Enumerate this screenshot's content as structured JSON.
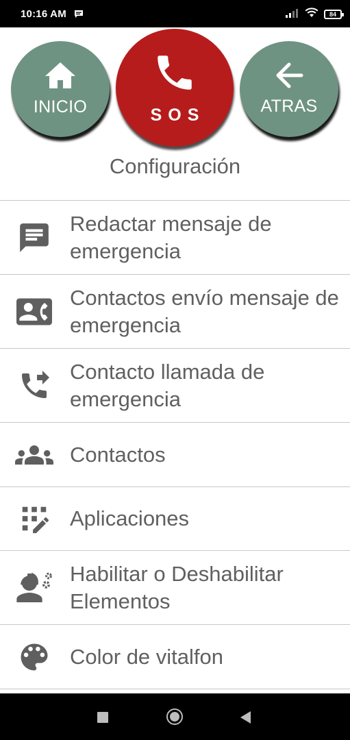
{
  "status_bar": {
    "time": "10:16 AM",
    "battery": "84",
    "icons": [
      "chat-bubble-icon",
      "signal-icon",
      "wifi-icon",
      "battery-icon"
    ]
  },
  "top_buttons": {
    "home": {
      "label": "INICIO",
      "icon": "home-icon",
      "color": "#6f9382"
    },
    "sos": {
      "label": "SOS",
      "icon": "phone-icon",
      "color": "#b71c1c"
    },
    "back": {
      "label": "ATRAS",
      "icon": "arrow-left-icon",
      "color": "#6f9382"
    }
  },
  "page": {
    "title": "Configuración"
  },
  "menu": {
    "items": [
      {
        "label": "Redactar mensaje de emergencia",
        "icon": "message-icon"
      },
      {
        "label": "Contactos envío mensaje de emergencia",
        "icon": "contact-phone-icon"
      },
      {
        "label": "Contacto llamada de emergencia",
        "icon": "phone-forwarded-icon"
      },
      {
        "label": "Contactos",
        "icon": "group-icon"
      },
      {
        "label": "Aplicaciones",
        "icon": "apps-edit-icon"
      },
      {
        "label": "Habilitar o Deshabilitar Elementos",
        "icon": "engineer-icon"
      },
      {
        "label": "Color de vitalfon",
        "icon": "palette-icon"
      }
    ]
  },
  "nav_bar": {
    "icons": [
      "recent-apps-icon",
      "home-circle-icon",
      "back-triangle-icon"
    ]
  },
  "colors": {
    "icon_gray": "#5f5f5f",
    "text_gray": "#606060",
    "divider": "#c8c8c8"
  }
}
